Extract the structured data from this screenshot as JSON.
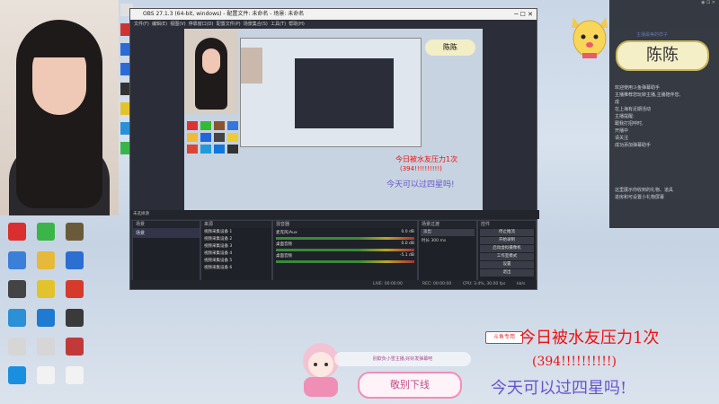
{
  "desktop_icons": [
    {
      "label": "",
      "color": "#d9302f"
    },
    {
      "label": "",
      "color": "#3bb54a"
    },
    {
      "label": "",
      "color": "#6b5a3a"
    },
    {
      "label": "",
      "color": "#3b7fd8"
    },
    {
      "label": "",
      "color": "#e6b93a"
    },
    {
      "label": "",
      "color": "#2b6fd1"
    },
    {
      "label": "",
      "color": "#444"
    },
    {
      "label": "",
      "color": "#e3c32b"
    },
    {
      "label": "",
      "color": "#d53a2a"
    },
    {
      "label": "",
      "color": "#2c90d6"
    },
    {
      "label": "",
      "color": "#1f7ad1"
    },
    {
      "label": "",
      "color": "#3a3a3a"
    },
    {
      "label": "",
      "color": "#d6d6d6"
    },
    {
      "label": "",
      "color": "#d6d6d6"
    },
    {
      "label": "",
      "color": "#c03a3a"
    },
    {
      "label": "",
      "color": "#1a8fe0"
    },
    {
      "label": "",
      "color": "#f2f2f2"
    },
    {
      "label": "",
      "color": "#f2f2f2"
    }
  ],
  "obs": {
    "title": "OBS 27.1.3 (64-bit, windows) - 配置文件: 未命名 - 场景: 未命名",
    "menu": [
      "文件(F)",
      "编辑(E)",
      "视图(V)",
      "停靠窗口(D)",
      "配置文件(P)",
      "场景集合(S)",
      "工具(T)",
      "帮助(H)"
    ],
    "preview_label": "未选择源",
    "docks": {
      "scenes": {
        "title": "场景",
        "items": [
          "场景"
        ]
      },
      "sources": {
        "title": "来源",
        "items": [
          "视频采集设备 1",
          "视频采集设备 2",
          "视频采集设备 3",
          "视频采集设备 4",
          "视频采集设备 5",
          "视频采集设备 6"
        ]
      },
      "mixer": {
        "title": "混音器",
        "channels": [
          {
            "name": "麦克风/Aux",
            "db": "0.0 dB"
          },
          {
            "name": "桌面音频",
            "db": "0.0 dB"
          },
          {
            "name": "桌面音频",
            "db": "-5.1 dB"
          }
        ]
      },
      "transitions": {
        "title": "场景过渡",
        "type": "淡出",
        "duration": "时长",
        "ms": "300 ms"
      },
      "controls": {
        "title": "控件",
        "buttons": [
          "停止推流",
          "开始录制",
          "启动虚拟摄像机",
          "工作室模式",
          "设置",
          "退出"
        ]
      }
    },
    "status": {
      "live": "LIVE: 00:00:00",
      "rec": "REC: 00:00:00",
      "cpu": "CPU: 3.4%, 30.00 fps",
      "kb": "kb/s"
    }
  },
  "chat": {
    "lines": [
      "欢迎使用斗鱼弹幕助手",
      "主播推荐您玩转主播,主播陪伴您,",
      "成",
      "在上海有近期活动",
      "主播提醒:",
      "跟我打招呼时,",
      "开播中",
      "请关注",
      "成功添加弹幕助手"
    ],
    "bottom_lines": [
      "这里展示你收到的礼物、道具",
      "进房和可设置小礼物屏幕"
    ]
  },
  "name_badge": "陈陈",
  "name_small": "主播最美的样子",
  "overlay": {
    "sticker": "斗鱼专用",
    "line1": "今日被水友压力1次",
    "line2": "(394!!!!!!!!!!)",
    "line3": "今天可以过四星吗!",
    "banner": "别欺负小雪主播,好好发弹幕吧",
    "button": "敬别下线"
  }
}
